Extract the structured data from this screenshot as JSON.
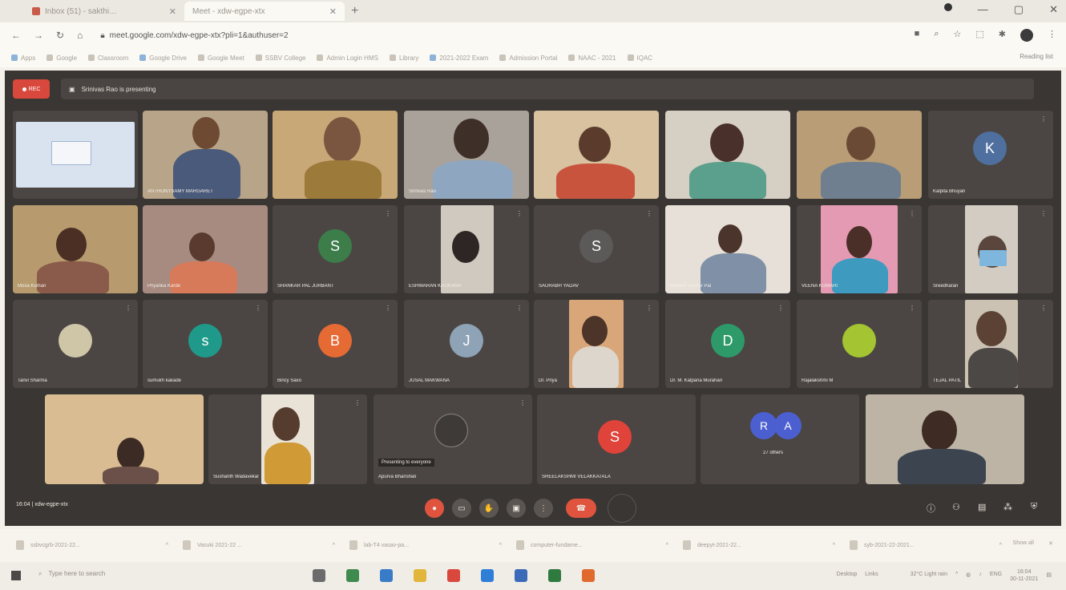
{
  "browser": {
    "tabs": [
      {
        "title": "Inbox (51) - sakthi…",
        "close": "✕"
      },
      {
        "title": "Meet - xdw-egpe-xtx",
        "close": "✕"
      }
    ],
    "new_tab": "+",
    "url": "meet.google.com/xdw-egpe-xtx?pli=1&authuser=2",
    "bookmarks": [
      "Apps",
      "Google",
      "Classroom",
      "Google Drive",
      "Google Meet",
      "SSBV College",
      "Admin Login HMS",
      "Library",
      "2021-2022 Exam",
      "Admission Portal",
      "NAAC - 2021",
      "IQAC"
    ],
    "reading_list": "Reading list"
  },
  "meet": {
    "rec_label": "REC",
    "presenting_text": "Srinivas Rao is presenting",
    "tiles": [
      {
        "name": ""
      },
      {
        "name": "ANTHONYSAMY MARGARET"
      },
      {
        "name": ""
      },
      {
        "name": "Srinivas Rao"
      },
      {
        "name": ""
      },
      {
        "name": ""
      },
      {
        "name": ""
      },
      {
        "name": "Kalpita Bhuyan",
        "letter": "K"
      },
      {
        "name": "Mosa Kumari"
      },
      {
        "name": "Priyanka Karde"
      },
      {
        "name": "SHANKAR PAL JURBANT",
        "letter": "S"
      },
      {
        "name": "ESHWARAN KATIKANA"
      },
      {
        "name": "SAURABH YADAV",
        "letter": "S"
      },
      {
        "name": "Mahesh Kumar Pal"
      },
      {
        "name": "VEENA KUMARI"
      },
      {
        "name": "Sreedharan"
      },
      {
        "name": "Tanvi Sharma"
      },
      {
        "name": "sumukh kakade",
        "letter": "s"
      },
      {
        "name": "Bincy Saxo",
        "letter": "B"
      },
      {
        "name": "JUSAL MAKWANA",
        "letter": "J"
      },
      {
        "name": "Dr. Priya"
      },
      {
        "name": "Dr. M. Kalpana Murahari",
        "letter": "D"
      },
      {
        "name": "Rajalakshmi M"
      },
      {
        "name": "TEJAL PATIL"
      },
      {
        "name": ""
      },
      {
        "name": "Sushanth Wadavekar"
      },
      {
        "name": "Apurva Bhanshali",
        "caption": "Presenting to everyone"
      },
      {
        "name": "SREELAKSHMI VELAKKATALA",
        "letter": "S"
      },
      {
        "name": "27 others",
        "letters": [
          "R",
          "A"
        ]
      },
      {
        "name": ""
      }
    ],
    "clock": "16:04 | xdw-egpe-xtx",
    "controls": [
      "mic",
      "cam",
      "hand",
      "present",
      "more",
      "end"
    ]
  },
  "downloads": [
    {
      "name": "ssbvcgrb-2021-22..."
    },
    {
      "name": "Vasuki 2021-22 ..."
    },
    {
      "name": "lab-T4 vasav-pa..."
    },
    {
      "name": "computer-fundame..."
    },
    {
      "name": "deepyt-2021-22..."
    },
    {
      "name": "syb-2021-22-2021..."
    }
  ],
  "downloads_show_all": "Show all",
  "taskbar": {
    "search_placeholder": "Type here to search",
    "weather": "32°C Light rain",
    "desktop": "Desktop",
    "links": "Links",
    "lang": "ENG",
    "time": "16:04",
    "date": "30-11-2021"
  },
  "colors": {
    "accent_red": "#e0533e",
    "meet_bg": "#3a3633",
    "tile_bg": "#4b4643"
  }
}
